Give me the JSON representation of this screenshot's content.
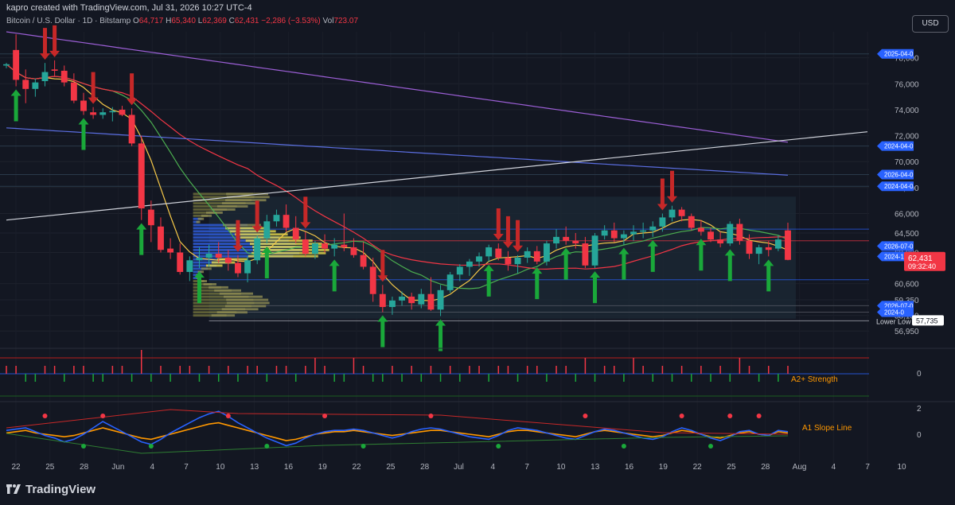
{
  "header": {
    "created": "kapro created with TradingView.com, Jul 31, 2026 10:27 UTC-4",
    "symbol": "Bitcoin / U.S. Dollar · 1D · Bitstamp",
    "o_label": "O",
    "o_value": "64,717",
    "h_label": "H",
    "h_value": "65,340",
    "l_label": "L",
    "l_value": "62,369",
    "c_label": "C",
    "c_value": "62,431",
    "change": "−2,286 (−3.53%)",
    "vol_label": "Vol",
    "vol_value": "723.07"
  },
  "currency_button": "USD",
  "brand": "TradingView",
  "chart_data": [
    {
      "type": "candlestick",
      "title": "Bitcoin / U.S. Dollar · 1D · Bitstamp",
      "ylim": [
        55800,
        80000
      ],
      "y_ticks": [
        "78,000",
        "76,000",
        "74,000",
        "72,000",
        "70,000",
        "68,000",
        "66,000",
        "64,500",
        "63,000",
        "60,600",
        "59,350",
        "58,150",
        "56,950"
      ],
      "x_ticks": [
        "22",
        "25",
        "28",
        "Jun",
        "4",
        "7",
        "10",
        "13",
        "16",
        "19",
        "22",
        "25",
        "28",
        "Jul",
        "4",
        "7",
        "10",
        "13",
        "16",
        "19",
        "22",
        "25",
        "28",
        "Aug",
        "4",
        "7",
        "10"
      ],
      "price_tags": [
        {
          "label": "2025-04-0",
          "value": 78300
        },
        {
          "label": "2024-04-0",
          "value": 71200
        },
        {
          "label": "2026-04-0",
          "value": 69000
        },
        {
          "label": "2024-04-0",
          "value": 68100
        },
        {
          "label": "2026-07-0",
          "value": 63500
        },
        {
          "label": "2024-10-0",
          "value": 62700
        },
        {
          "label": "2026-07-0",
          "value": 58900
        },
        {
          "label": "2024-0",
          "value": 58400
        }
      ],
      "current_price": "62,431",
      "countdown": "09:32:40",
      "lower_low_label": "Lower Low",
      "lower_low_value": "57,735",
      "ohlc": [
        [
          77400,
          77600,
          77200,
          77500
        ],
        [
          78600,
          79800,
          75800,
          76300
        ],
        [
          76300,
          77100,
          74500,
          75600
        ],
        [
          75600,
          76400,
          75000,
          76100
        ],
        [
          76200,
          77600,
          75800,
          76900
        ],
        [
          77100,
          77800,
          76600,
          77000
        ],
        [
          77000,
          77400,
          75800,
          76100
        ],
        [
          76100,
          76800,
          74500,
          74700
        ],
        [
          74700,
          75300,
          73600,
          73900
        ],
        [
          73800,
          74200,
          73300,
          73600
        ],
        [
          73600,
          74100,
          73300,
          73800
        ],
        [
          73800,
          74200,
          73100,
          73900
        ],
        [
          74000,
          74300,
          73500,
          73600
        ],
        [
          73600,
          74100,
          71200,
          71400
        ],
        [
          71400,
          72000,
          65500,
          66400
        ],
        [
          66300,
          67000,
          63800,
          65100
        ],
        [
          65000,
          65700,
          63000,
          63200
        ],
        [
          63300,
          64100,
          62500,
          63000
        ],
        [
          63000,
          63700,
          61300,
          61500
        ],
        [
          61500,
          62700,
          60800,
          62400
        ],
        [
          62400,
          63400,
          61800,
          62600
        ],
        [
          62600,
          63600,
          61900,
          62900
        ],
        [
          62900,
          63800,
          62200,
          62600
        ],
        [
          62600,
          63200,
          61600,
          62200
        ],
        [
          62200,
          62800,
          61100,
          61400
        ],
        [
          61400,
          62700,
          60700,
          62400
        ],
        [
          62400,
          64300,
          62100,
          64100
        ],
        [
          64100,
          65900,
          63700,
          65400
        ],
        [
          65400,
          66300,
          65000,
          65900
        ],
        [
          65900,
          66700,
          64600,
          64900
        ],
        [
          64900,
          65800,
          63700,
          64000
        ],
        [
          64000,
          64600,
          62700,
          62900
        ],
        [
          62900,
          63900,
          62500,
          63700
        ],
        [
          63700,
          64400,
          63000,
          63300
        ],
        [
          63300,
          64100,
          62700,
          63600
        ],
        [
          63600,
          66000,
          63100,
          63400
        ],
        [
          63400,
          64100,
          62600,
          62800
        ],
        [
          62800,
          63800,
          61700,
          61900
        ],
        [
          61900,
          62600,
          59200,
          59800
        ],
        [
          59800,
          60500,
          58400,
          58800
        ],
        [
          58800,
          59600,
          58200,
          59300
        ],
        [
          59300,
          60000,
          58900,
          59600
        ],
        [
          59600,
          59900,
          58600,
          59100
        ],
        [
          59000,
          60200,
          58700,
          59800
        ],
        [
          59800,
          61100,
          58500,
          58600
        ],
        [
          58600,
          60500,
          58100,
          60100
        ],
        [
          60100,
          61500,
          59900,
          61300
        ],
        [
          61300,
          62100,
          60800,
          61900
        ],
        [
          61900,
          62500,
          61200,
          62300
        ],
        [
          62300,
          63000,
          61900,
          62700
        ],
        [
          62700,
          63600,
          62300,
          63400
        ],
        [
          63300,
          63700,
          62400,
          62600
        ],
        [
          62600,
          63100,
          61600,
          62100
        ],
        [
          62100,
          62800,
          61400,
          62600
        ],
        [
          62600,
          63400,
          62200,
          63100
        ],
        [
          63100,
          63500,
          62100,
          62300
        ],
        [
          62300,
          63900,
          62000,
          63700
        ],
        [
          63700,
          64800,
          63300,
          64200
        ],
        [
          64200,
          65000,
          63600,
          63900
        ],
        [
          63900,
          64500,
          63300,
          63700
        ],
        [
          63700,
          64200,
          61800,
          62000
        ],
        [
          62000,
          64500,
          61800,
          64300
        ],
        [
          64300,
          65100,
          64000,
          64700
        ],
        [
          64700,
          65300,
          63800,
          64100
        ],
        [
          64100,
          64700,
          63600,
          64400
        ],
        [
          64400,
          65100,
          63900,
          64600
        ],
        [
          64600,
          65300,
          64100,
          64700
        ],
        [
          64700,
          65400,
          64200,
          65000
        ],
        [
          65000,
          66000,
          64600,
          65700
        ],
        [
          65700,
          66600,
          65400,
          66300
        ],
        [
          66300,
          66500,
          65400,
          65800
        ],
        [
          65800,
          66000,
          64700,
          64900
        ],
        [
          64900,
          65500,
          64300,
          64600
        ],
        [
          64600,
          64900,
          63800,
          64000
        ],
        [
          64000,
          64600,
          63400,
          63700
        ],
        [
          63700,
          65400,
          63500,
          65200
        ],
        [
          65200,
          65600,
          63600,
          63900
        ],
        [
          63900,
          64400,
          62500,
          62900
        ],
        [
          62900,
          63600,
          62100,
          63400
        ],
        [
          63400,
          63900,
          62700,
          63200
        ],
        [
          63300,
          64300,
          63100,
          64000
        ],
        [
          64700,
          65300,
          62400,
          62431
        ]
      ],
      "up_color": "#26a69a",
      "down_color": "#f23645",
      "moving_averages": [
        "#f7c948",
        "#4caf50",
        "#f23645",
        "#5b6ee1",
        "#9c5fd6"
      ]
    },
    {
      "type": "bar",
      "title": "A2+ Strength",
      "zero_label": "0",
      "values": [
        1,
        1,
        -1,
        -1,
        1,
        1,
        -1,
        1,
        1,
        -1,
        -1,
        1,
        1,
        -1,
        3,
        -1,
        1,
        -1,
        1,
        1,
        -1,
        1,
        -1,
        1,
        -1,
        1,
        1,
        -1,
        1,
        1,
        -1,
        1,
        2,
        1,
        -1,
        -1,
        2,
        1,
        -1,
        -1,
        1,
        -1,
        1,
        -1,
        1,
        -1,
        1,
        -1,
        1,
        1,
        -1,
        1,
        1,
        -1,
        1,
        1,
        -1,
        1,
        1,
        -1,
        2,
        -1,
        1,
        1,
        -1,
        2,
        1,
        -1,
        1,
        -1,
        1,
        -1,
        1,
        -1,
        1,
        -1,
        2,
        1,
        -1,
        1,
        -1,
        1,
        -2,
        2
      ]
    },
    {
      "type": "line",
      "title": "A1 Slope Line",
      "y_ticks": [
        "2",
        "0"
      ],
      "series": [
        {
          "color": "#ff9800",
          "values": [
            0.1,
            0.2,
            0.3,
            0.1,
            0,
            -0.1,
            -0.2,
            -0.1,
            0.1,
            0.3,
            0.5,
            0.3,
            0.1,
            -0.1,
            -0.3,
            -0.4,
            -0.2,
            0,
            0.2,
            0.4,
            0.6,
            0.8,
            0.9,
            0.7,
            0.5,
            0.3,
            0.1,
            -0.1,
            -0.3,
            -0.5,
            -0.4,
            -0.2,
            0,
            0.1,
            0.2,
            0.2,
            0.3,
            0.2,
            0.1,
            0,
            -0.1,
            0,
            0.1,
            0.2,
            0.3,
            0.3,
            0.2,
            0.1,
            0,
            -0.1,
            -0.2,
            0,
            0.2,
            0.3,
            0.3,
            0.2,
            0.1,
            0,
            -0.1,
            -0.2,
            0,
            0.2,
            0.3,
            0.2,
            0.1,
            0,
            -0.1,
            -0.2,
            -0.1,
            0.1,
            0.3,
            0.2,
            0,
            -0.2,
            -0.3,
            -0.1,
            0.1,
            0.2,
            0,
            -0.1,
            0.2,
            0.1
          ]
        },
        {
          "color": "#2962ff",
          "values": [
            0.3,
            0.4,
            0.5,
            0.2,
            -0.1,
            -0.3,
            -0.6,
            -0.4,
            0,
            0.5,
            1,
            0.6,
            0.2,
            -0.2,
            -0.6,
            -0.8,
            -0.4,
            0.1,
            0.5,
            0.9,
            1.3,
            1.6,
            1.8,
            1.4,
            0.9,
            0.5,
            0.1,
            -0.3,
            -0.6,
            -0.9,
            -0.7,
            -0.3,
            0,
            0.2,
            0.3,
            0.3,
            0.4,
            0.3,
            0.1,
            -0.1,
            -0.3,
            -0.1,
            0.2,
            0.4,
            0.5,
            0.4,
            0.2,
            0,
            -0.2,
            -0.3,
            -0.4,
            -0.1,
            0.3,
            0.5,
            0.4,
            0.3,
            0.1,
            -0.1,
            -0.3,
            -0.4,
            -0.1,
            0.2,
            0.4,
            0.3,
            0.1,
            -0.1,
            -0.3,
            -0.4,
            -0.2,
            0.2,
            0.5,
            0.3,
            0,
            -0.3,
            -0.5,
            -0.2,
            0.2,
            0.3,
            0,
            -0.1,
            0.3,
            0.2
          ]
        }
      ]
    }
  ],
  "icons": {
    "brand_logo": "tradingview-logo-icon"
  }
}
